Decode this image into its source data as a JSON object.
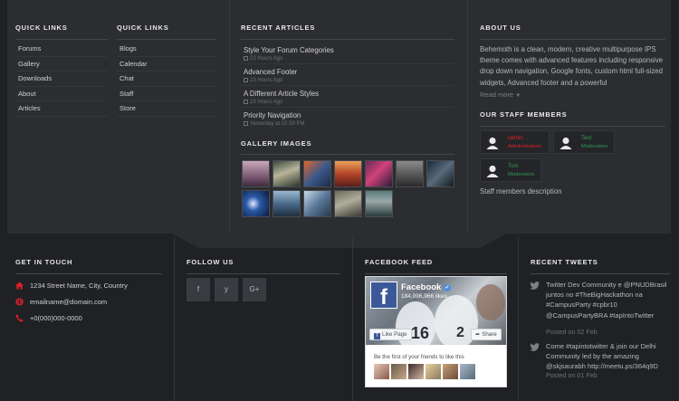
{
  "quick_links_1": {
    "title": "QUICK LINKS",
    "items": [
      "Forums",
      "Gallery",
      "Downloads",
      "About",
      "Articles"
    ]
  },
  "quick_links_2": {
    "title": "QUICK LINKS",
    "items": [
      "Blogs",
      "Calendar",
      "Chat",
      "Staff",
      "Store"
    ]
  },
  "recent_articles": {
    "title": "RECENT ARTICLES",
    "items": [
      {
        "title": "Style Your Forum Categories",
        "time": "23 Hours Ago"
      },
      {
        "title": "Advanced Footer",
        "time": "23 Hours Ago"
      },
      {
        "title": "A Different Article Styles",
        "time": "23 Hours Ago"
      },
      {
        "title": "Priority Navigation",
        "time": "Yesterday at 02:39 PM"
      }
    ]
  },
  "gallery": {
    "title": "GALLERY IMAGES"
  },
  "about": {
    "title": "ABOUT US",
    "text": "Behemoth is a clean, modern, creative multipurpose IPS theme comes with advanced features including responsive drop down navigation, Google fonts, custom html full-sized widgets, Advanced footer and a powerful",
    "read_more": "Read more"
  },
  "staff": {
    "title": "OUR STAFF MEMBERS",
    "members": [
      {
        "name": "tatmin",
        "role": "Administrators",
        "color": "#e0202a"
      },
      {
        "name": "Test",
        "role": "Moderators",
        "color": "#2e9a55"
      },
      {
        "name": "Tom",
        "role": "Moderators",
        "color": "#2e9a55"
      }
    ],
    "description": "Staff members description"
  },
  "get_in_touch": {
    "title": "GET IN TOUCH",
    "address": "1234 Street Name, City, Country",
    "email": "emailname@domain.com",
    "phone": "+0(000)000-0000",
    "icon_color": "#e0202a"
  },
  "follow_us": {
    "title": "FOLLOW US",
    "icons": [
      "f",
      "y",
      "G+"
    ]
  },
  "facebook_feed": {
    "title": "FACEBOOK FEED",
    "page_name": "Facebook",
    "likes": "184,096,966 likes",
    "like_btn": "Like Page",
    "share_btn": "Share",
    "friends_text": "Be the first of your friends to like this"
  },
  "recent_tweets": {
    "title": "RECENT TWEETS",
    "items": [
      {
        "text": "Twitter Dev Community e @PNUDBrasil juntos no #TheBigHackathon na #CampusParty #cpbr10 @CampusPartyBRA #tapIntoTwitter",
        "date": "Posted on 02 Feb"
      },
      {
        "text": "Come #tapintotwitter & join our Delhi Community led by the amazing @skjsaurabh http://meetu.ps/364q9D",
        "date": "Posted on 01 Feb"
      }
    ]
  },
  "colors": {
    "accent": "#e0202a",
    "panel": "#2c2d31",
    "background": "#202124"
  }
}
